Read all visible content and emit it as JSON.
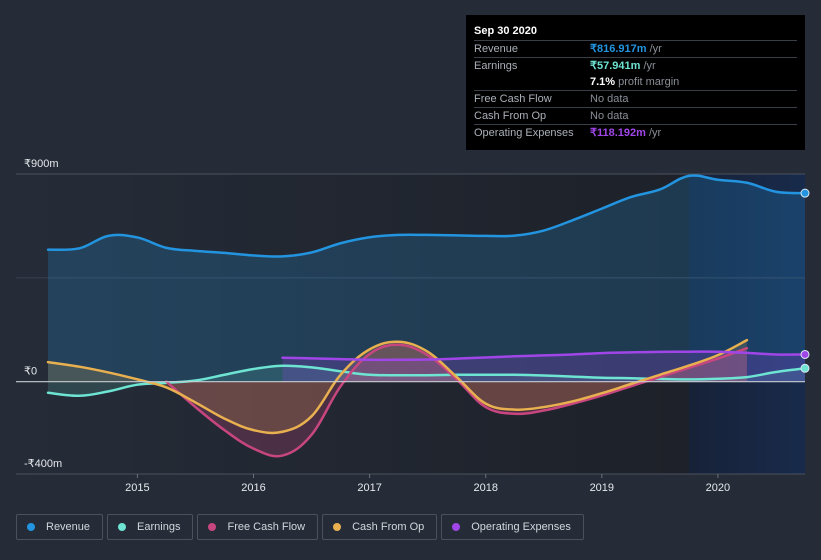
{
  "tooltip": {
    "date": "Sep 30 2020",
    "rows": [
      {
        "label": "Revenue",
        "value": "₹816.917m",
        "suffix": " /yr",
        "color": "#2394df"
      },
      {
        "label": "Earnings",
        "value": "₹57.941m",
        "suffix": " /yr",
        "color": "#6ee4d3"
      },
      {
        "label": "",
        "value": "7.1%",
        "suffix": " profit margin",
        "color": "#ffffff"
      },
      {
        "label": "Free Cash Flow",
        "value": "",
        "suffix": "No data",
        "color": "#8a8f97"
      },
      {
        "label": "Cash From Op",
        "value": "",
        "suffix": "No data",
        "color": "#8a8f97"
      },
      {
        "label": "Operating Expenses",
        "value": "₹118.192m",
        "suffix": " /yr",
        "color": "#a046e8"
      }
    ]
  },
  "legend": [
    {
      "label": "Revenue",
      "color": "#2394df"
    },
    {
      "label": "Earnings",
      "color": "#6ee4d3"
    },
    {
      "label": "Free Cash Flow",
      "color": "#c8467f"
    },
    {
      "label": "Cash From Op",
      "color": "#e8b04f"
    },
    {
      "label": "Operating Expenses",
      "color": "#a046e8"
    }
  ],
  "chart_data": {
    "type": "area",
    "title": "",
    "xlabel": "",
    "ylabel": "",
    "ylim": [
      -400,
      900
    ],
    "xlim": [
      2014.23,
      2020.75
    ],
    "y_ticks": [
      {
        "value": 900,
        "label": "₹900m"
      },
      {
        "value": 0,
        "label": "₹0"
      },
      {
        "value": -400,
        "label": "-₹400m"
      }
    ],
    "x_ticks": [
      {
        "value": 2015,
        "label": "2015"
      },
      {
        "value": 2016,
        "label": "2016"
      },
      {
        "value": 2017,
        "label": "2017"
      },
      {
        "value": 2018,
        "label": "2018"
      },
      {
        "value": 2019,
        "label": "2019"
      },
      {
        "value": 2020,
        "label": "2020"
      }
    ],
    "highlight_from": 2019.75,
    "grid": true,
    "legend_position": "bottom",
    "series": [
      {
        "name": "Revenue",
        "color": "#2394df",
        "x": [
          2014.23,
          2014.5,
          2014.75,
          2015.0,
          2015.25,
          2015.5,
          2015.75,
          2016.0,
          2016.25,
          2016.5,
          2016.75,
          2017.0,
          2017.25,
          2017.5,
          2017.75,
          2018.0,
          2018.25,
          2018.5,
          2018.75,
          2019.0,
          2019.25,
          2019.5,
          2019.75,
          2020.0,
          2020.25,
          2020.5,
          2020.75
        ],
        "values": [
          572,
          578,
          632,
          625,
          580,
          567,
          558,
          547,
          543,
          560,
          600,
          626,
          636,
          636,
          634,
          632,
          633,
          655,
          700,
          750,
          800,
          833,
          892,
          875,
          862,
          823,
          817
        ]
      },
      {
        "name": "Earnings",
        "color": "#6ee4d3",
        "x": [
          2014.23,
          2014.5,
          2014.75,
          2015.0,
          2015.25,
          2015.5,
          2015.75,
          2016.0,
          2016.25,
          2016.5,
          2016.75,
          2017.0,
          2017.25,
          2017.5,
          2017.75,
          2018.0,
          2018.25,
          2018.5,
          2018.75,
          2019.0,
          2019.25,
          2019.5,
          2019.75,
          2020.0,
          2020.25,
          2020.5,
          2020.75
        ],
        "values": [
          -48,
          -61,
          -42,
          -13,
          -5,
          5,
          30,
          55,
          69,
          62,
          45,
          30,
          28,
          28,
          30,
          30,
          30,
          27,
          22,
          17,
          15,
          12,
          10,
          13,
          20,
          42,
          58
        ]
      },
      {
        "name": "Free Cash Flow",
        "color": "#c8467f",
        "x": [
          2015.25,
          2015.5,
          2015.75,
          2016.0,
          2016.25,
          2016.5,
          2016.75,
          2017.0,
          2017.25,
          2017.5,
          2017.75,
          2018.0,
          2018.25,
          2018.5,
          2018.75,
          2019.0,
          2019.25,
          2019.5,
          2019.75,
          2020.0,
          2020.25
        ],
        "values": [
          0,
          -110,
          -210,
          -290,
          -320,
          -230,
          -20,
          120,
          160,
          115,
          10,
          -110,
          -139,
          -125,
          -95,
          -60,
          -20,
          20,
          60,
          100,
          145
        ]
      },
      {
        "name": "Cash From Op",
        "color": "#e8b04f",
        "x": [
          2014.23,
          2014.5,
          2014.75,
          2015.0,
          2015.25,
          2015.5,
          2015.75,
          2016.0,
          2016.25,
          2016.5,
          2016.75,
          2017.0,
          2017.25,
          2017.5,
          2017.75,
          2018.0,
          2018.25,
          2018.5,
          2018.75,
          2019.0,
          2019.25,
          2019.5,
          2019.75,
          2020.0,
          2020.25
        ],
        "values": [
          85,
          65,
          40,
          10,
          -25,
          -90,
          -160,
          -210,
          -217,
          -150,
          30,
          140,
          173,
          130,
          20,
          -95,
          -121,
          -110,
          -85,
          -50,
          -10,
          30,
          70,
          115,
          180
        ]
      },
      {
        "name": "Operating Expenses",
        "color": "#a046e8",
        "x": [
          2016.25,
          2016.5,
          2016.75,
          2017.0,
          2017.25,
          2017.5,
          2017.75,
          2018.0,
          2018.25,
          2018.5,
          2018.75,
          2019.0,
          2019.25,
          2019.5,
          2019.75,
          2020.0,
          2020.25,
          2020.5,
          2020.75
        ],
        "values": [
          104,
          101,
          98,
          95,
          95,
          96,
          100,
          105,
          110,
          114,
          118,
          124,
          127,
          129,
          130,
          130,
          125,
          118,
          118
        ]
      }
    ]
  }
}
